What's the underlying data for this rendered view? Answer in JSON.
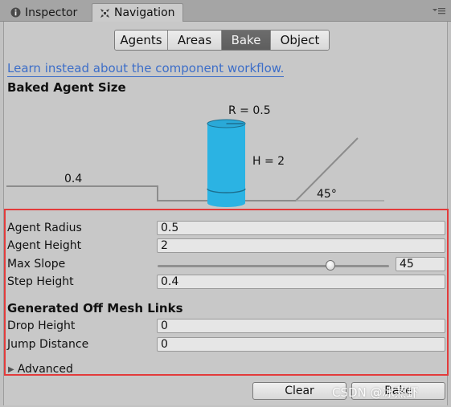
{
  "tabs": [
    {
      "label": "Inspector",
      "icon": "info-icon",
      "active": false
    },
    {
      "label": "Navigation",
      "icon": "navigation-icon",
      "active": true
    }
  ],
  "segments": [
    {
      "label": "Agents",
      "selected": false
    },
    {
      "label": "Areas",
      "selected": false
    },
    {
      "label": "Bake",
      "selected": true
    },
    {
      "label": "Object",
      "selected": false
    }
  ],
  "link_text": "Learn instead about the component workflow.",
  "baked_agent_size": {
    "title": "Baked Agent Size",
    "diagram": {
      "radius_label": "R = 0.5",
      "height_label": "H = 2",
      "step_label": "0.4",
      "slope_label": "45°"
    }
  },
  "settings": {
    "agent_radius": {
      "label": "Agent Radius",
      "value": "0.5"
    },
    "agent_height": {
      "label": "Agent Height",
      "value": "2"
    },
    "max_slope": {
      "label": "Max Slope",
      "value": "45",
      "min": 0,
      "max": 60
    },
    "step_height": {
      "label": "Step Height",
      "value": "0.4"
    }
  },
  "off_mesh": {
    "title": "Generated Off Mesh Links",
    "drop_height": {
      "label": "Drop Height",
      "value": "0"
    },
    "jump_distance": {
      "label": "Jump Distance",
      "value": "0"
    }
  },
  "advanced_label": "Advanced",
  "buttons": {
    "clear": "Clear",
    "bake": "Bake"
  },
  "watermark": "CSDN @冰蒸虾",
  "colors": {
    "cylinder": "#2bb3e3",
    "link": "#3d6ec8",
    "highlight": "#e33b3b",
    "selected_segment": "#636363"
  }
}
